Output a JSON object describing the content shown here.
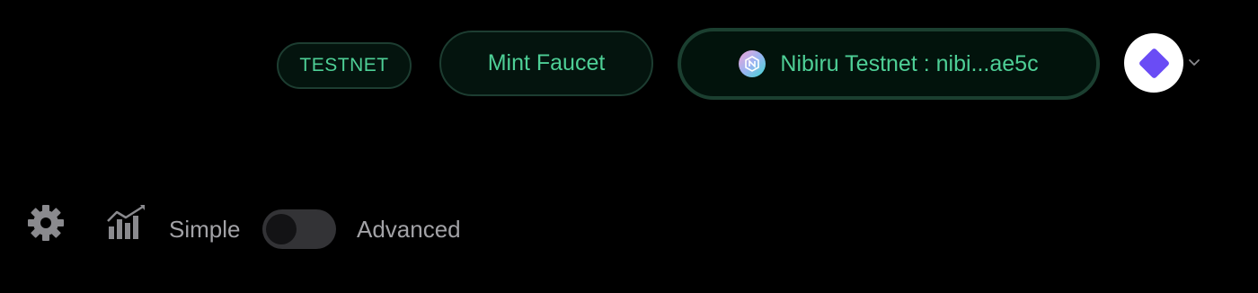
{
  "header": {
    "network_badge": "TESTNET",
    "faucet_label": "Mint Faucet",
    "wallet_label": "Nibiru Testnet : nibi...ae5c",
    "wallet_logo_icon": "nibiru-logo-icon",
    "avatar_icon": "diamond-icon",
    "menu_icon": "chevron-down-icon"
  },
  "controls": {
    "settings_icon": "gear-icon",
    "chart_icon": "bar-chart-icon",
    "simple_label": "Simple",
    "advanced_label": "Advanced",
    "mode_advanced": false
  },
  "colors": {
    "accent": "#4ecf96",
    "button_border": "#1d3d31",
    "button_bg": "#04140e",
    "avatar_accent": "#6a4cf5",
    "muted_text": "#a2a2a6"
  }
}
